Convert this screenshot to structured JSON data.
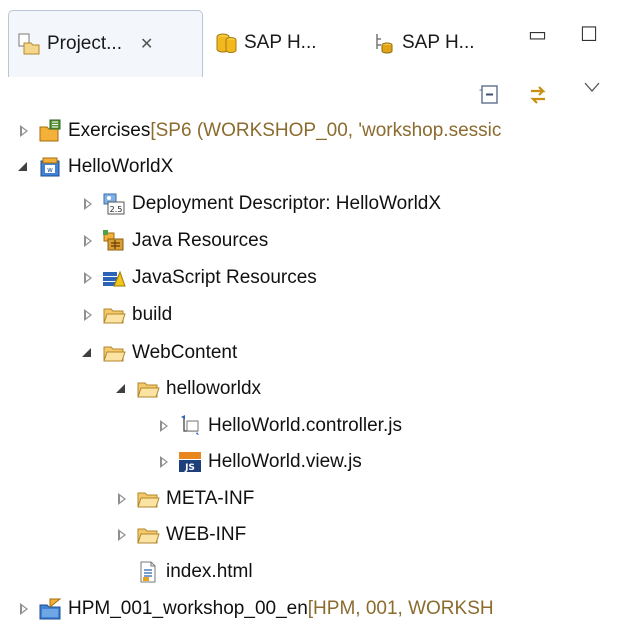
{
  "tabs": [
    {
      "label": "Project...",
      "close": "✕",
      "icon": "project-explorer-icon"
    },
    {
      "label": "SAP H...",
      "icon": "sap-hana-systems-icon"
    },
    {
      "label": "SAP H...",
      "icon": "sap-hana-repositories-icon"
    }
  ],
  "view_controls": {
    "minimize": "▭",
    "maximize": "☐"
  },
  "toolbar": {
    "collapse_all": "collapse-all-icon",
    "link_editor": "link-with-editor-icon",
    "menu": "view-menu-icon"
  },
  "tree": [
    {
      "label": "Exercises",
      "decoration": " [SP6 (WORKSHOP_00, 'workshop.sessic",
      "icon": "shared-project-icon",
      "state": "collapsed"
    },
    {
      "label": "HelloWorldX",
      "decoration": "",
      "icon": "web-project-icon",
      "state": "expanded"
    },
    {
      "label": "Deployment Descriptor: HelloWorldX",
      "decoration": "",
      "icon": "deployment-descriptor-icon",
      "state": "collapsed"
    },
    {
      "label": "Java Resources",
      "decoration": "",
      "icon": "java-resources-icon",
      "state": "collapsed"
    },
    {
      "label": "JavaScript Resources",
      "decoration": "",
      "icon": "javascript-resources-icon",
      "state": "collapsed"
    },
    {
      "label": "build",
      "decoration": "",
      "icon": "folder-icon",
      "state": "collapsed"
    },
    {
      "label": "WebContent",
      "decoration": "",
      "icon": "folder-icon",
      "state": "expanded"
    },
    {
      "label": "helloworldx",
      "decoration": "",
      "icon": "folder-icon",
      "state": "expanded"
    },
    {
      "label": "HelloWorld.controller.js",
      "decoration": "",
      "icon": "js-file-icon",
      "state": "collapsed"
    },
    {
      "label": "HelloWorld.view.js",
      "decoration": "",
      "icon": "js-view-file-icon",
      "state": "collapsed"
    },
    {
      "label": "META-INF",
      "decoration": "",
      "icon": "folder-icon",
      "state": "collapsed"
    },
    {
      "label": "WEB-INF",
      "decoration": "",
      "icon": "folder-icon",
      "state": "collapsed"
    },
    {
      "label": "index.html",
      "decoration": "",
      "icon": "html-file-icon",
      "state": "leaf"
    },
    {
      "label": "HPM_001_workshop_00_en",
      "decoration": " [HPM, 001, WORKSH",
      "icon": "hana-project-icon",
      "state": "collapsed"
    }
  ]
}
